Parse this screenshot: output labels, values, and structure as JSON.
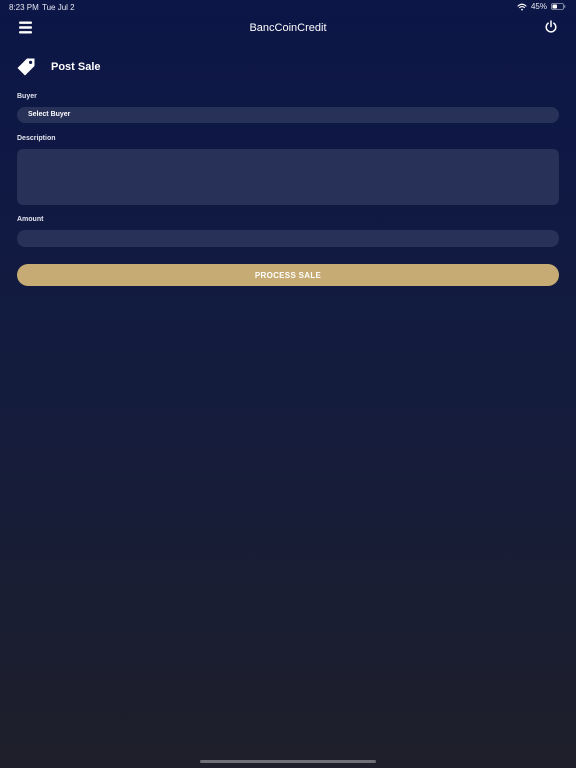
{
  "status_bar": {
    "time": "8:23 PM",
    "date": "Tue Jul 2",
    "battery_percent": "45%",
    "battery_level": 0.45,
    "icons": [
      "wifi-icon",
      "battery-icon"
    ]
  },
  "nav": {
    "title": "BancCoinCredit",
    "left_icon": "menu-icon",
    "right_icon": "power-icon"
  },
  "page": {
    "title": "Post Sale",
    "icon": "tag-icon"
  },
  "form": {
    "buyer": {
      "label": "Buyer",
      "selected": "Select Buyer"
    },
    "description": {
      "label": "Description",
      "value": ""
    },
    "amount": {
      "label": "Amount",
      "value": ""
    },
    "submit_label": "PROCESS SALE"
  },
  "colors": {
    "background_top": "#0c1647",
    "background_bottom": "#1e1f2a",
    "field": "#283157",
    "accent": "#c6ac74",
    "text": "#ffffff"
  }
}
